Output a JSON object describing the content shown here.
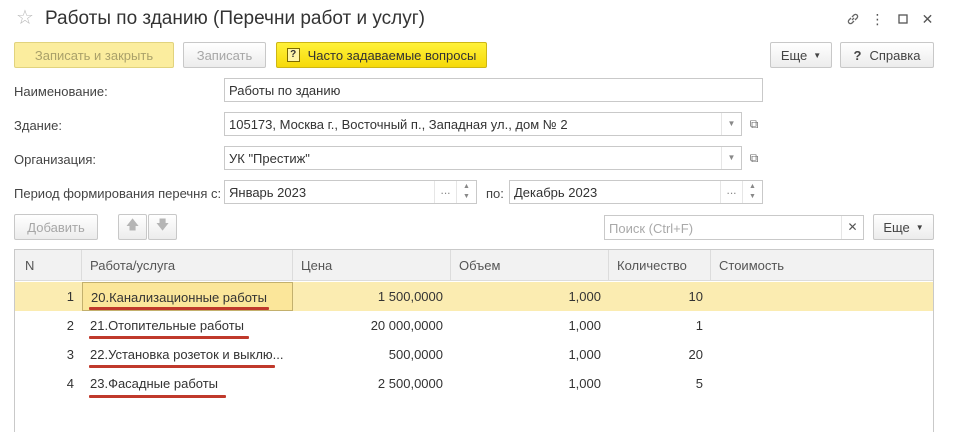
{
  "window": {
    "title": "Работы по зданию (Перечни работ и услуг)",
    "star_icon": "star-icon",
    "controls": [
      "link-icon",
      "more-icon",
      "maximize-icon",
      "close-icon"
    ]
  },
  "toolbar": {
    "save_close": "Записать и закрыть",
    "save": "Записать",
    "faq": "Часто задаваемые вопросы",
    "more": "Еще",
    "help": "Справка"
  },
  "form": {
    "name_label": "Наименование:",
    "name_value": "Работы по зданию",
    "building_label": "Здание:",
    "building_value": "105173, Москва г., Восточный п., Западная ул., дом № 2",
    "org_label": "Организация:",
    "org_value": "УК \"Престиж\"",
    "period_label": "Период формирования перечня с:",
    "period_from": "Январь 2023",
    "period_to_label": "по:",
    "period_to": "Декабрь 2023"
  },
  "table_toolbar": {
    "add": "Добавить",
    "search_placeholder": "Поиск (Ctrl+F)",
    "more": "Еще"
  },
  "table": {
    "columns": [
      "N",
      "Работа/услуга",
      "Цена",
      "Объем",
      "Количество",
      "Стоимость"
    ],
    "rows": [
      {
        "n": "1",
        "work": "20.Канализационные работы",
        "price": "1 500,0000",
        "volume": "1,000",
        "qty": "10",
        "cost": ""
      },
      {
        "n": "2",
        "work": "21.Отопительные работы",
        "price": "20 000,0000",
        "volume": "1,000",
        "qty": "1",
        "cost": ""
      },
      {
        "n": "3",
        "work": "22.Установка розеток и выклю...",
        "price": "500,0000",
        "volume": "1,000",
        "qty": "20",
        "cost": ""
      },
      {
        "n": "4",
        "work": "23.Фасадные работы",
        "price": "2 500,0000",
        "volume": "1,000",
        "qty": "5",
        "cost": ""
      }
    ],
    "selected_row": 1
  },
  "colors": {
    "selection": "#fbecb1",
    "faq_button": "#f6d90a",
    "underline": "#c0392b"
  }
}
